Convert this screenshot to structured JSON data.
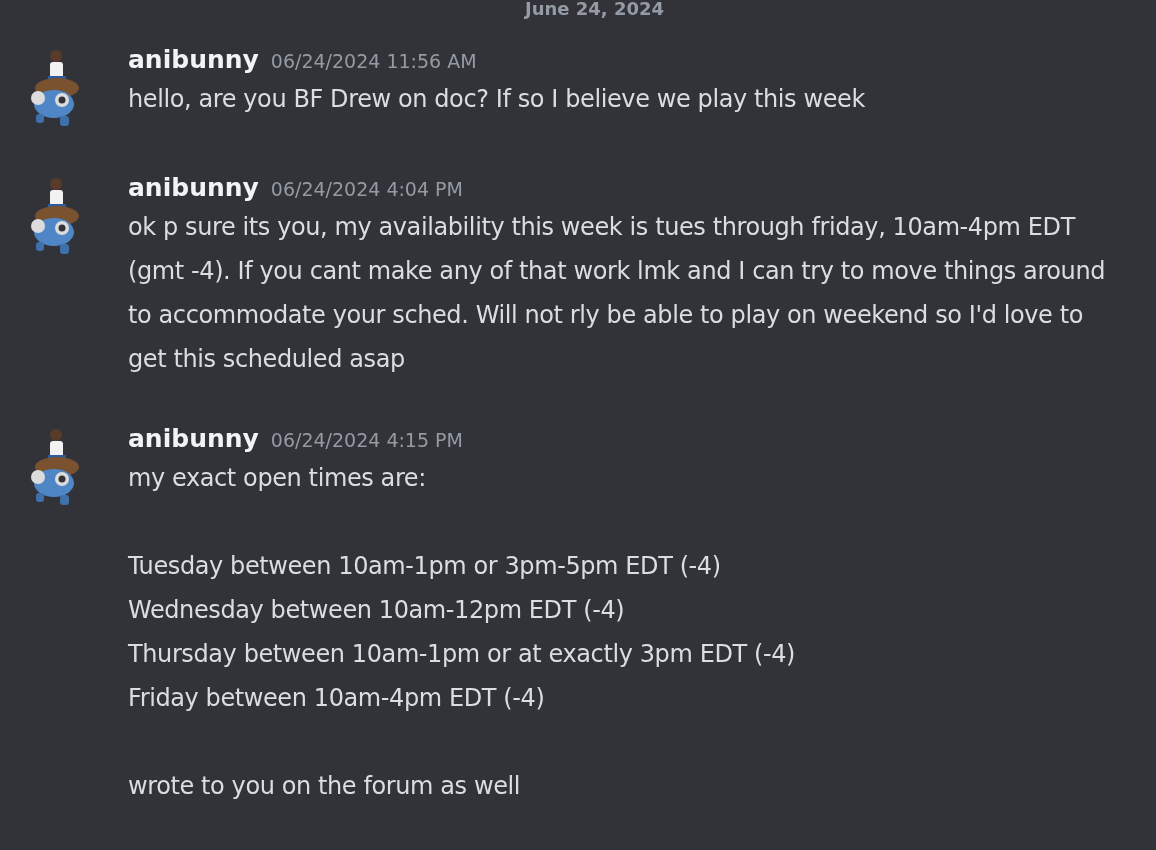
{
  "date_divider": "June 24, 2024",
  "messages": [
    {
      "author": "anibunny",
      "timestamp": "06/24/2024 11:56 AM",
      "paragraphs": [
        [
          "hello, are you BF Drew on doc? If so I believe we play this week"
        ]
      ]
    },
    {
      "author": "anibunny",
      "timestamp": "06/24/2024 4:04 PM",
      "paragraphs": [
        [
          "ok p sure its you, my availability this week is tues through friday, 10am-4pm EDT (gmt -4). If you cant make any of that work lmk and I can try to move things around to accommodate your sched. Will not rly be able to play on weekend so I'd love to get this scheduled asap"
        ]
      ]
    },
    {
      "author": "anibunny",
      "timestamp": "06/24/2024 4:15 PM",
      "paragraphs": [
        [
          "my exact open times are:"
        ],
        [
          "Tuesday between 10am-1pm or 3pm-5pm EDT (-4)",
          "Wednesday between 10am-12pm EDT (-4)",
          "Thursday between 10am-1pm or at exactly 3pm EDT (-4)",
          "Friday between 10am-4pm EDT (-4)"
        ],
        [
          "wrote to you on the forum as well"
        ]
      ]
    }
  ]
}
